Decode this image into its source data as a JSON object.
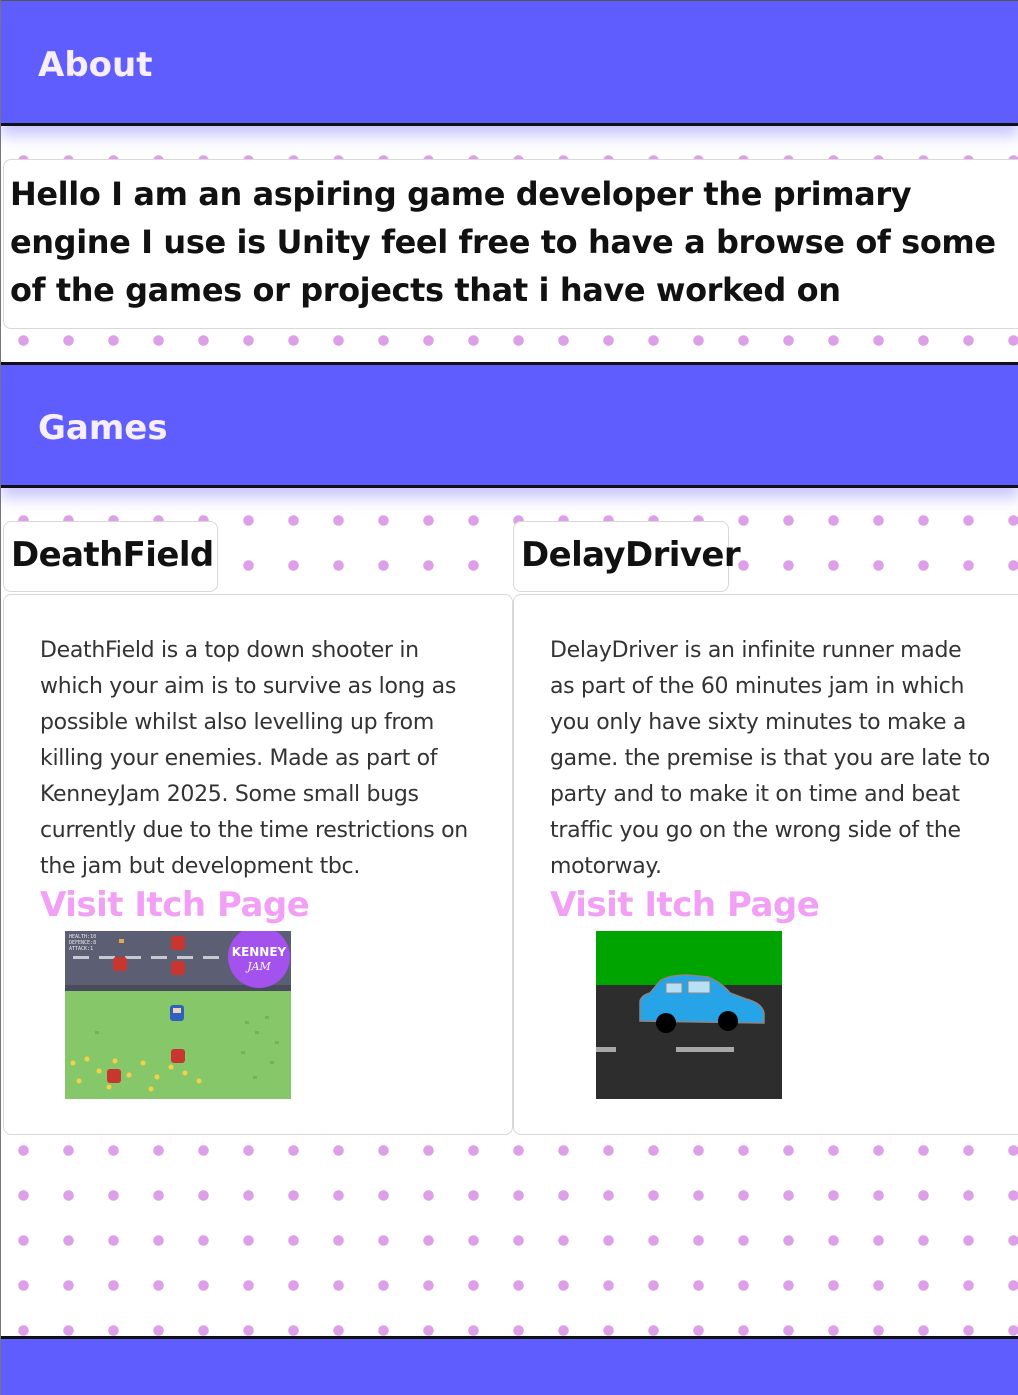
{
  "about": {
    "heading": "About",
    "text": "Hello I am an aspiring game developer the primary engine I use is Unity feel free to have a browse of some of the games or projects that i have worked on"
  },
  "games": {
    "heading": "Games",
    "items": [
      {
        "title": "DeathField",
        "description": "DeathField is a top down shooter in which your aim is to survive as long as possible whilst also levelling up from killing your enemies. Made as part of KenneyJam 2025. Some small bugs currently due to the time restrictions on the jam but development tbc.",
        "link_label": "Visit Itch Page",
        "image_overlay": {
          "hud_lines": [
            "HEALTH:10",
            "DEFENCE:8",
            "ATTACK:1"
          ],
          "badge_top": "KENNEY",
          "badge_bottom": "JAM"
        }
      },
      {
        "title": "DelayDriver",
        "description": "DelayDriver is an infinite runner made as part of the 60 minutes jam in which you only have sixty minutes to make a game. the premise is that you are late to party and to make it on time and beat traffic you go on the wrong side of the motorway.",
        "link_label": "Visit Itch Page"
      }
    ]
  },
  "colors": {
    "header_bg": "#5f5dfd",
    "header_text": "#f6eefc",
    "link": "#f2a0f5",
    "dots": "#dda0e8"
  }
}
